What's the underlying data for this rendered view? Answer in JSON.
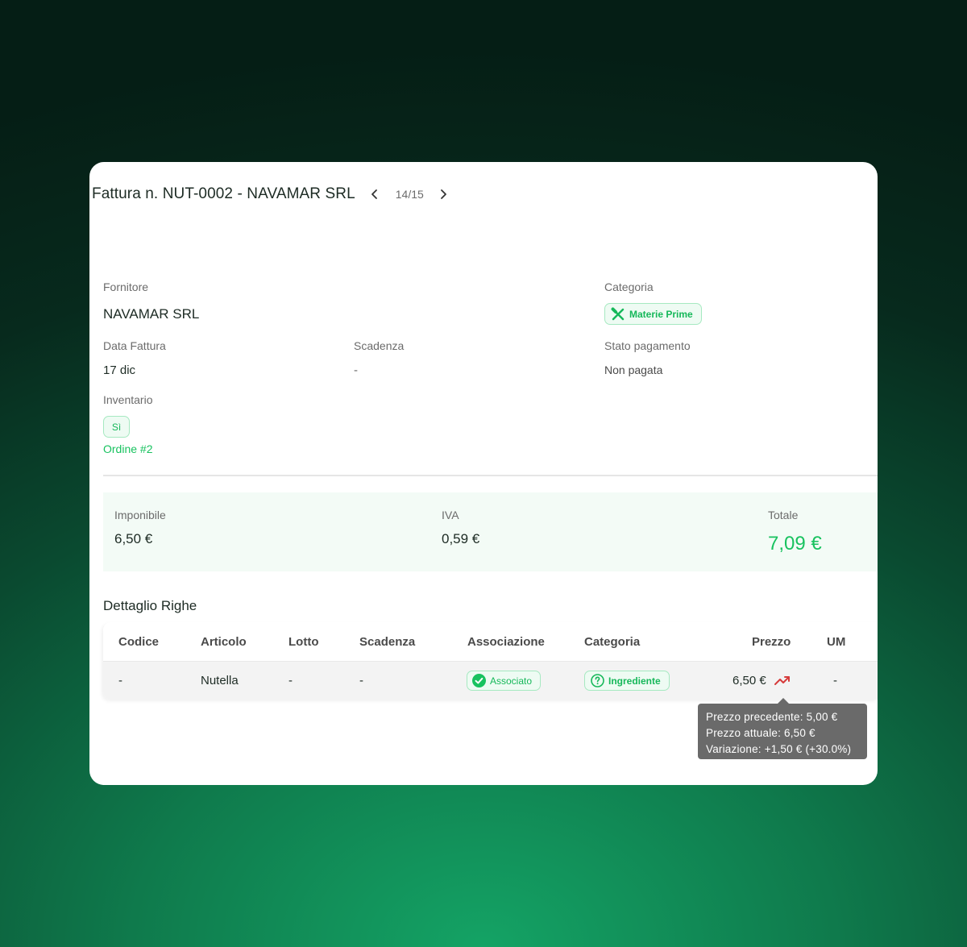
{
  "header": {
    "title": "Fattura n. NUT-0002 - NAVAMAR SRL",
    "counter": "14/15"
  },
  "details": {
    "fornitore_label": "Fornitore",
    "fornitore_value": "NAVAMAR SRL",
    "categoria_label": "Categoria",
    "categoria_badge": "Materie Prime",
    "data_label": "Data Fattura",
    "data_value": "17 dic",
    "scadenza_label": "Scadenza",
    "scadenza_value": "-",
    "stato_label": "Stato pagamento",
    "stato_value": "Non pagata",
    "inventario_label": "Inventario",
    "inventario_badge": "Sì",
    "ordine_link": "Ordine #2"
  },
  "totals": {
    "imponibile_label": "Imponibile",
    "imponibile_value": "6,50 €",
    "iva_label": "IVA",
    "iva_value": "0,59 €",
    "totale_label": "Totale",
    "totale_value": "7,09 €"
  },
  "lines": {
    "section_title": "Dettaglio Righe",
    "columns": [
      "Codice",
      "Articolo",
      "Lotto",
      "Scadenza",
      "Associazione",
      "Categoria",
      "Prezzo",
      "UM"
    ],
    "rows": [
      {
        "codice": "-",
        "articolo": "Nutella",
        "lotto": "-",
        "scadenza": "-",
        "associazione": "Associato",
        "categoria": "Ingrediente",
        "prezzo": "6,50 €",
        "um": "-"
      }
    ]
  },
  "tooltip": {
    "line1": "Prezzo precedente: 5,00 €",
    "line2": "Prezzo attuale: 6,50 €",
    "line3": "Variazione: +1,50 € (+30.0%)"
  },
  "colors": {
    "accent": "#18c25f",
    "trend_up": "#d63b3b"
  },
  "icons": [
    "chevron-left-icon",
    "chevron-right-icon",
    "fork-knife-icon",
    "check-circle-icon",
    "question-circle-icon",
    "trending-up-icon"
  ]
}
